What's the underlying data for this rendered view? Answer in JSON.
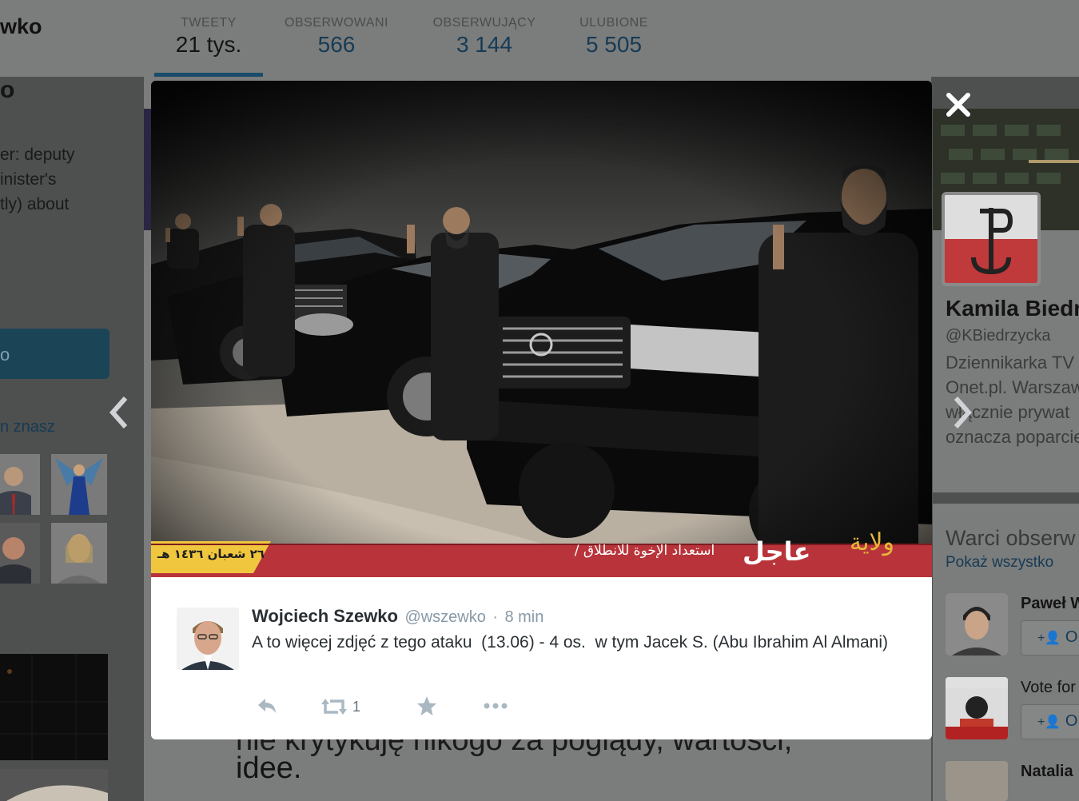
{
  "profile": {
    "name_fragment": "wko",
    "name_big_fragment": "o",
    "bio_lines": [
      "er: deputy",
      "inister's",
      "tly) about"
    ],
    "button_label": "o",
    "link_label": "n znasz"
  },
  "stats": [
    {
      "label": "TWEETY",
      "value": "21 tys."
    },
    {
      "label": "OBSERWOWANI",
      "value": "566"
    },
    {
      "label": "OBSERWUJĄCY",
      "value": "3 144"
    },
    {
      "label": "ULUBIONE",
      "value": "5 505"
    }
  ],
  "background_text": {
    "ghost_line": "nie krytykuję nikogo za poglądy, wartości,",
    "line": "idee."
  },
  "right_card": {
    "name": "Kamila Biedr",
    "handle": "@KBiedrzycka",
    "bio_lines": [
      "Dziennikarka TV",
      "Onet.pl. Warszaw",
      "włącznie prywat",
      "oznacza poparcie"
    ],
    "who_title": "Warci obserw",
    "who_link": "Pokaż wszystko",
    "suggestions": [
      {
        "name": "Paweł W",
        "button": "O"
      },
      {
        "name": "Vote for",
        "button": "O"
      },
      {
        "name": "Natalia",
        "button": ""
      }
    ]
  },
  "modal": {
    "close_icon": "close-icon",
    "image_banner": {
      "left_text": "٢٦ شعبان ١٤٣٦ هـ",
      "mid_text": "استعداد الإخوة للانطلاق /",
      "big_text": "عاجل",
      "logo_text": "ولاية"
    },
    "tweet": {
      "author_name": "Wojciech Szewko",
      "author_handle": "@wszewko",
      "separator": "·",
      "time": "8 min",
      "text": "A to więcej zdjęć z tego ataku  (13.06) - 4 os.  w tym Jacek S. (Abu Ibrahim Al Almani)",
      "retweet_count": "1"
    }
  },
  "colors": {
    "overlay_bg": "#4f5050",
    "link_blue": "#163b55",
    "banner_red": "#b8343a",
    "banner_yellow": "#f0c63e"
  }
}
